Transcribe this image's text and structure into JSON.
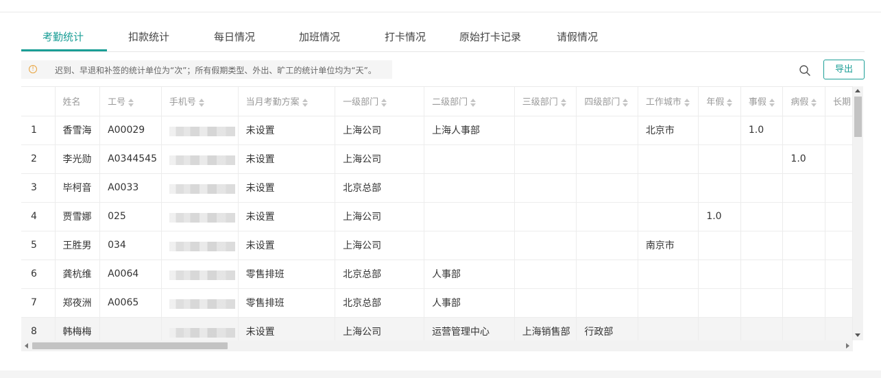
{
  "tabs": [
    {
      "label": "考勤统计",
      "active": true
    },
    {
      "label": "扣款统计",
      "active": false
    },
    {
      "label": "每日情况",
      "active": false
    },
    {
      "label": "加班情况",
      "active": false
    },
    {
      "label": "打卡情况",
      "active": false
    },
    {
      "label": "原始打卡记录",
      "active": false
    },
    {
      "label": "请假情况",
      "active": false
    }
  ],
  "notice": {
    "icon": "info-icon",
    "text": "迟到、早退和补签的统计单位为“次”；所有假期类型、外出、旷工的统计单位均为“天”。"
  },
  "toolbar": {
    "search_icon": "search-icon",
    "export_label": "导出"
  },
  "table": {
    "columns": [
      "",
      "姓名",
      "工号",
      "手机号",
      "当月考勤方案",
      "一级部门",
      "二级部门",
      "三级部门",
      "四级部门",
      "工作城市",
      "年假",
      "事假",
      "病假",
      "长期"
    ],
    "rows": [
      {
        "idx": "1",
        "name": "香雪海",
        "id": "A00029",
        "plan": "未设置",
        "d1": "上海公司",
        "d2": "上海人事部",
        "d3": "",
        "d4": "",
        "city": "北京市",
        "annual": "",
        "personal": "1.0",
        "sick": ""
      },
      {
        "idx": "2",
        "name": "李光勋",
        "id": "A0344545",
        "plan": "未设置",
        "d1": "上海公司",
        "d2": "",
        "d3": "",
        "d4": "",
        "city": "",
        "annual": "",
        "personal": "",
        "sick": "1.0"
      },
      {
        "idx": "3",
        "name": "毕柯音",
        "id": "A0033",
        "plan": "未设置",
        "d1": "北京总部",
        "d2": "",
        "d3": "",
        "d4": "",
        "city": "",
        "annual": "",
        "personal": "",
        "sick": ""
      },
      {
        "idx": "4",
        "name": "贾雪娜",
        "id": "025",
        "plan": "未设置",
        "d1": "上海公司",
        "d2": "",
        "d3": "",
        "d4": "",
        "city": "",
        "annual": "1.0",
        "personal": "",
        "sick": ""
      },
      {
        "idx": "5",
        "name": "王胜男",
        "id": "034",
        "plan": "未设置",
        "d1": "上海公司",
        "d2": "",
        "d3": "",
        "d4": "",
        "city": "南京市",
        "annual": "",
        "personal": "",
        "sick": ""
      },
      {
        "idx": "6",
        "name": "龚杭维",
        "id": "A0064",
        "plan": "零售排班",
        "d1": "北京总部",
        "d2": "人事部",
        "d3": "",
        "d4": "",
        "city": "",
        "annual": "",
        "personal": "",
        "sick": ""
      },
      {
        "idx": "7",
        "name": "郑夜洲",
        "id": "A0065",
        "plan": "零售排班",
        "d1": "北京总部",
        "d2": "人事部",
        "d3": "",
        "d4": "",
        "city": "",
        "annual": "",
        "personal": "",
        "sick": ""
      },
      {
        "idx": "8",
        "name": "韩梅梅",
        "id": "",
        "plan": "未设置",
        "d1": "上海公司",
        "d2": "运营管理中心",
        "d3": "上海销售部",
        "d4": "行政部",
        "city": "",
        "annual": "",
        "personal": "",
        "sick": ""
      }
    ]
  },
  "colors": {
    "accent": "#1a9e96",
    "warning": "#e8a33d"
  }
}
